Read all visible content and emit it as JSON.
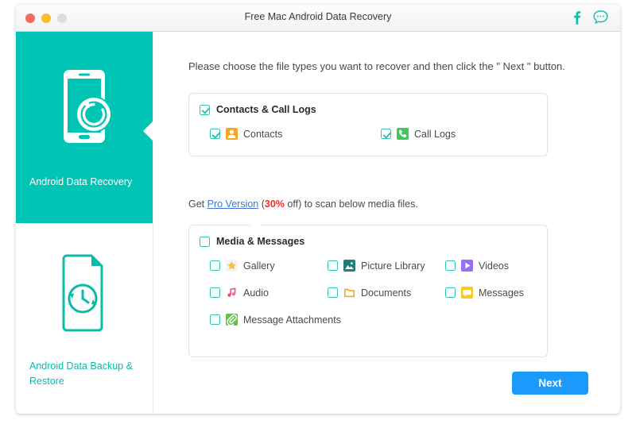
{
  "window": {
    "title": "Free Mac Android Data Recovery",
    "controls": [
      "close",
      "minimize",
      "zoom"
    ],
    "titlebar_icons": [
      "facebook-icon",
      "chat-bubble-icon"
    ]
  },
  "sidebar": {
    "items": [
      {
        "label": "Android Data Recovery",
        "icon": "phone-recovery-icon",
        "active": true
      },
      {
        "label": "Android Data Backup & Restore",
        "icon": "document-clock-restore-icon",
        "active": false
      }
    ]
  },
  "main": {
    "instruction": "Please choose the file types you want to recover and then click the \" Next \" button.",
    "promo": {
      "prefix": "Get ",
      "link": "Pro Version",
      "open_paren": " (",
      "discount": "30%",
      "off": " off)",
      "suffix": " to scan below media files."
    },
    "next_label": "Next",
    "groups": [
      {
        "title": "Contacts & Call Logs",
        "checked": true,
        "rows": [
          [
            {
              "label": "Contacts",
              "icon": "contacts-icon",
              "checked": true
            },
            {
              "label": "Call Logs",
              "icon": "call-logs-icon",
              "checked": true
            }
          ]
        ]
      },
      {
        "title": "Media & Messages",
        "checked": false,
        "rows": [
          [
            {
              "label": "Gallery",
              "icon": "gallery-icon",
              "checked": false
            },
            {
              "label": "Picture Library",
              "icon": "picture-library-icon",
              "checked": false
            },
            {
              "label": "Videos",
              "icon": "videos-icon",
              "checked": false
            }
          ],
          [
            {
              "label": "Audio",
              "icon": "audio-icon",
              "checked": false
            },
            {
              "label": "Documents",
              "icon": "documents-icon",
              "checked": false
            },
            {
              "label": "Messages",
              "icon": "messages-icon",
              "checked": false
            }
          ],
          [
            {
              "label": "Message Attachments",
              "icon": "message-attachments-icon",
              "checked": false
            }
          ]
        ]
      }
    ]
  },
  "colors": {
    "brand_teal": "#00c4b4",
    "checkbox_teal": "#2fc4b2",
    "next_blue": "#1a9bfc",
    "link_blue": "#3f77d6",
    "discount_red": "#ef2b2b",
    "contacts_orange": "#f5a623",
    "call_logs_green": "#3ec860",
    "gallery_gold": "#f7c13a",
    "picture_library_teal": "#1f7f75",
    "videos_purple": "#9b6ef3",
    "audio_pink": "#ef4a6b",
    "documents_orange": "#f5a623",
    "messages_yellow": "#fcc81c",
    "attachments_green": "#62c košt"
  }
}
